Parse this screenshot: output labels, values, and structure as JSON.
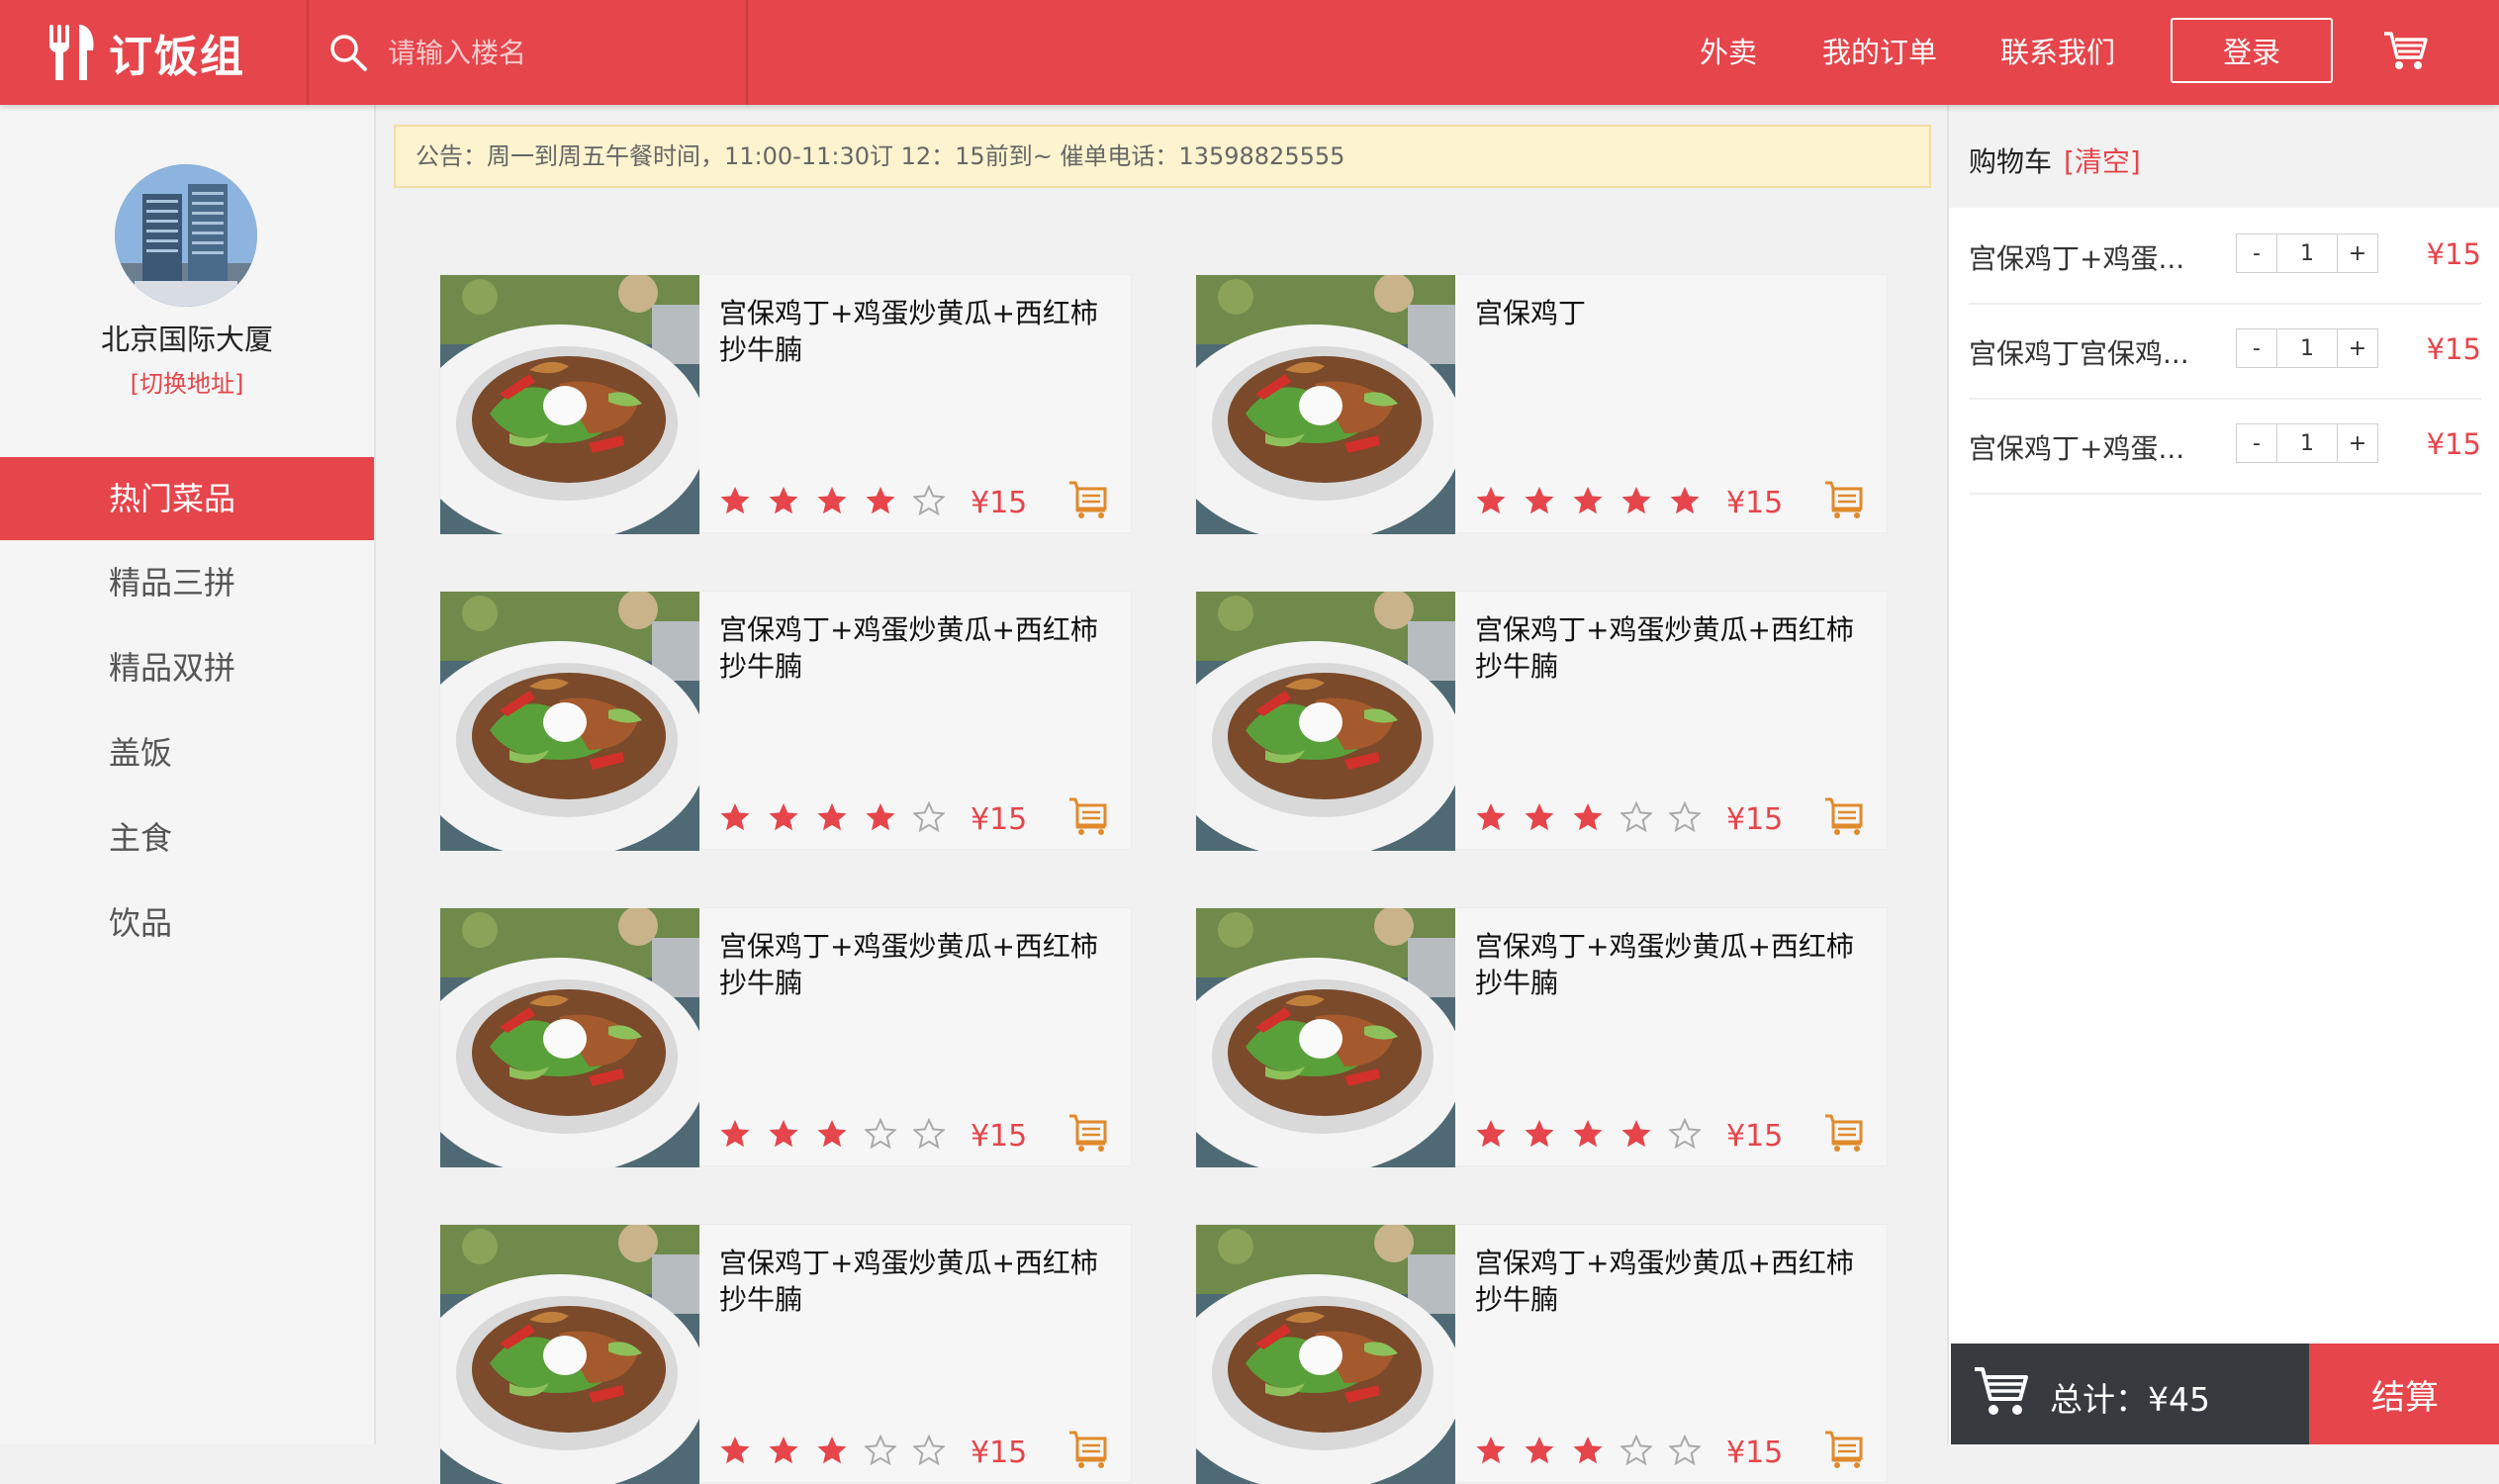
{
  "brand": {
    "name": "订饭组",
    "logo_icon": "fork-knife-icon",
    "color": "#e5454b"
  },
  "search": {
    "placeholder": "请输入楼名",
    "icon": "search-icon"
  },
  "nav": {
    "takeout": "外卖",
    "orders": "我的订单",
    "contact": "联系我们",
    "login": "登录"
  },
  "location": {
    "name": "北京国际大厦",
    "switch": "[切换地址]"
  },
  "categories": [
    {
      "label": "热门菜品",
      "active": true
    },
    {
      "label": "精品三拼",
      "active": false
    },
    {
      "label": "精品双拼",
      "active": false
    },
    {
      "label": "盖饭",
      "active": false
    },
    {
      "label": "主食",
      "active": false
    },
    {
      "label": "饮品",
      "active": false
    }
  ],
  "notice": "公告：周一到周五午餐时间，11:00-11:30订 12：15前到~ 催单电话：13598825555",
  "dishes": [
    {
      "name": "宫保鸡丁+鸡蛋炒黄瓜+西红柿抄牛腩",
      "rating": 4,
      "price": "¥15"
    },
    {
      "name": "宫保鸡丁",
      "rating": 5,
      "price": "¥15"
    },
    {
      "name": "宫保鸡丁+鸡蛋炒黄瓜+西红柿抄牛腩",
      "rating": 4,
      "price": "¥15"
    },
    {
      "name": "宫保鸡丁+鸡蛋炒黄瓜+西红柿抄牛腩",
      "rating": 3,
      "price": "¥15"
    },
    {
      "name": "宫保鸡丁+鸡蛋炒黄瓜+西红柿抄牛腩",
      "rating": 3,
      "price": "¥15"
    },
    {
      "name": "宫保鸡丁+鸡蛋炒黄瓜+西红柿抄牛腩",
      "rating": 4,
      "price": "¥15"
    },
    {
      "name": "宫保鸡丁+鸡蛋炒黄瓜+西红柿抄牛腩",
      "rating": 3,
      "price": "¥15"
    },
    {
      "name": "宫保鸡丁+鸡蛋炒黄瓜+西红柿抄牛腩",
      "rating": 3,
      "price": "¥15"
    }
  ],
  "cart": {
    "title": "购物车",
    "clear": "[清空]",
    "items": [
      {
        "name": "宫保鸡丁+鸡蛋...",
        "qty": "1",
        "price": "¥15"
      },
      {
        "name": "宫保鸡丁宫保鸡...",
        "qty": "1",
        "price": "¥15"
      },
      {
        "name": "宫保鸡丁+鸡蛋...",
        "qty": "1",
        "price": "¥15"
      }
    ],
    "minus": "-",
    "plus": "+",
    "total": "总计：¥45",
    "checkout": "结算"
  }
}
